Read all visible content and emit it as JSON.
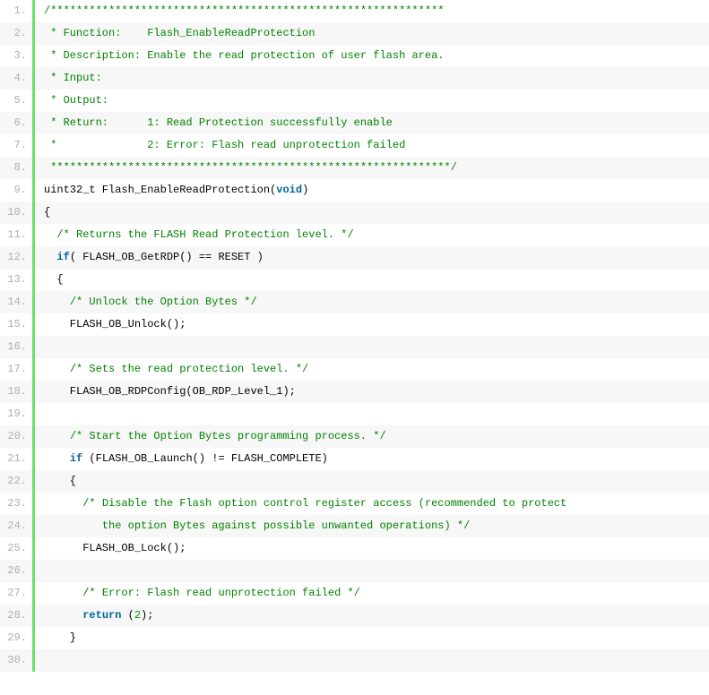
{
  "code": {
    "lines": [
      {
        "num": "1.",
        "tokens": [
          {
            "t": "comment",
            "v": "/*************************************************************"
          }
        ]
      },
      {
        "num": "2.",
        "tokens": [
          {
            "t": "comment",
            "v": " * Function:    Flash_EnableReadProtection"
          }
        ]
      },
      {
        "num": "3.",
        "tokens": [
          {
            "t": "comment",
            "v": " * Description: Enable the read protection of user flash area."
          }
        ]
      },
      {
        "num": "4.",
        "tokens": [
          {
            "t": "comment",
            "v": " * Input:"
          }
        ]
      },
      {
        "num": "5.",
        "tokens": [
          {
            "t": "comment",
            "v": " * Output:"
          }
        ]
      },
      {
        "num": "6.",
        "tokens": [
          {
            "t": "comment",
            "v": " * Return:      1: Read Protection successfully enable"
          }
        ]
      },
      {
        "num": "7.",
        "tokens": [
          {
            "t": "comment",
            "v": " *              2: Error: Flash read unprotection failed"
          }
        ]
      },
      {
        "num": "8.",
        "tokens": [
          {
            "t": "comment",
            "v": " **************************************************************/"
          }
        ]
      },
      {
        "num": "9.",
        "tokens": [
          {
            "t": "plain",
            "v": "uint32_t Flash_EnableReadProtection("
          },
          {
            "t": "keyword",
            "v": "void"
          },
          {
            "t": "plain",
            "v": ")"
          }
        ]
      },
      {
        "num": "10.",
        "tokens": [
          {
            "t": "plain",
            "v": "{"
          }
        ]
      },
      {
        "num": "11.",
        "tokens": [
          {
            "t": "plain",
            "v": "  "
          },
          {
            "t": "comment",
            "v": "/* Returns the FLASH Read Protection level. */"
          }
        ]
      },
      {
        "num": "12.",
        "tokens": [
          {
            "t": "plain",
            "v": "  "
          },
          {
            "t": "keyword",
            "v": "if"
          },
          {
            "t": "plain",
            "v": "( FLASH_OB_GetRDP() == RESET )"
          }
        ]
      },
      {
        "num": "13.",
        "tokens": [
          {
            "t": "plain",
            "v": "  {"
          }
        ]
      },
      {
        "num": "14.",
        "tokens": [
          {
            "t": "plain",
            "v": "    "
          },
          {
            "t": "comment",
            "v": "/* Unlock the Option Bytes */"
          }
        ]
      },
      {
        "num": "15.",
        "tokens": [
          {
            "t": "plain",
            "v": "    FLASH_OB_Unlock();"
          }
        ]
      },
      {
        "num": "16.",
        "tokens": [
          {
            "t": "plain",
            "v": " "
          }
        ]
      },
      {
        "num": "17.",
        "tokens": [
          {
            "t": "plain",
            "v": "    "
          },
          {
            "t": "comment",
            "v": "/* Sets the read protection level. */"
          }
        ]
      },
      {
        "num": "18.",
        "tokens": [
          {
            "t": "plain",
            "v": "    FLASH_OB_RDPConfig(OB_RDP_Level_1);"
          }
        ]
      },
      {
        "num": "19.",
        "tokens": [
          {
            "t": "plain",
            "v": " "
          }
        ]
      },
      {
        "num": "20.",
        "tokens": [
          {
            "t": "plain",
            "v": "    "
          },
          {
            "t": "comment",
            "v": "/* Start the Option Bytes programming process. */"
          }
        ]
      },
      {
        "num": "21.",
        "tokens": [
          {
            "t": "plain",
            "v": "    "
          },
          {
            "t": "keyword",
            "v": "if"
          },
          {
            "t": "plain",
            "v": " (FLASH_OB_Launch() != FLASH_COMPLETE)"
          }
        ]
      },
      {
        "num": "22.",
        "tokens": [
          {
            "t": "plain",
            "v": "    {"
          }
        ]
      },
      {
        "num": "23.",
        "tokens": [
          {
            "t": "plain",
            "v": "      "
          },
          {
            "t": "comment",
            "v": "/* Disable the Flash option control register access (recommended to protect"
          }
        ]
      },
      {
        "num": "24.",
        "tokens": [
          {
            "t": "plain",
            "v": "         "
          },
          {
            "t": "comment",
            "v": "the option Bytes against possible unwanted operations) */"
          }
        ]
      },
      {
        "num": "25.",
        "tokens": [
          {
            "t": "plain",
            "v": "      FLASH_OB_Lock();"
          }
        ]
      },
      {
        "num": "26.",
        "tokens": [
          {
            "t": "plain",
            "v": " "
          }
        ]
      },
      {
        "num": "27.",
        "tokens": [
          {
            "t": "plain",
            "v": "      "
          },
          {
            "t": "comment",
            "v": "/* Error: Flash read unprotection failed */"
          }
        ]
      },
      {
        "num": "28.",
        "tokens": [
          {
            "t": "plain",
            "v": "      "
          },
          {
            "t": "keyword",
            "v": "return"
          },
          {
            "t": "plain",
            "v": " ("
          },
          {
            "t": "num",
            "v": "2"
          },
          {
            "t": "plain",
            "v": ");"
          }
        ]
      },
      {
        "num": "29.",
        "tokens": [
          {
            "t": "plain",
            "v": "    }"
          }
        ]
      },
      {
        "num": "30.",
        "tokens": [
          {
            "t": "plain",
            "v": " "
          }
        ]
      }
    ]
  }
}
